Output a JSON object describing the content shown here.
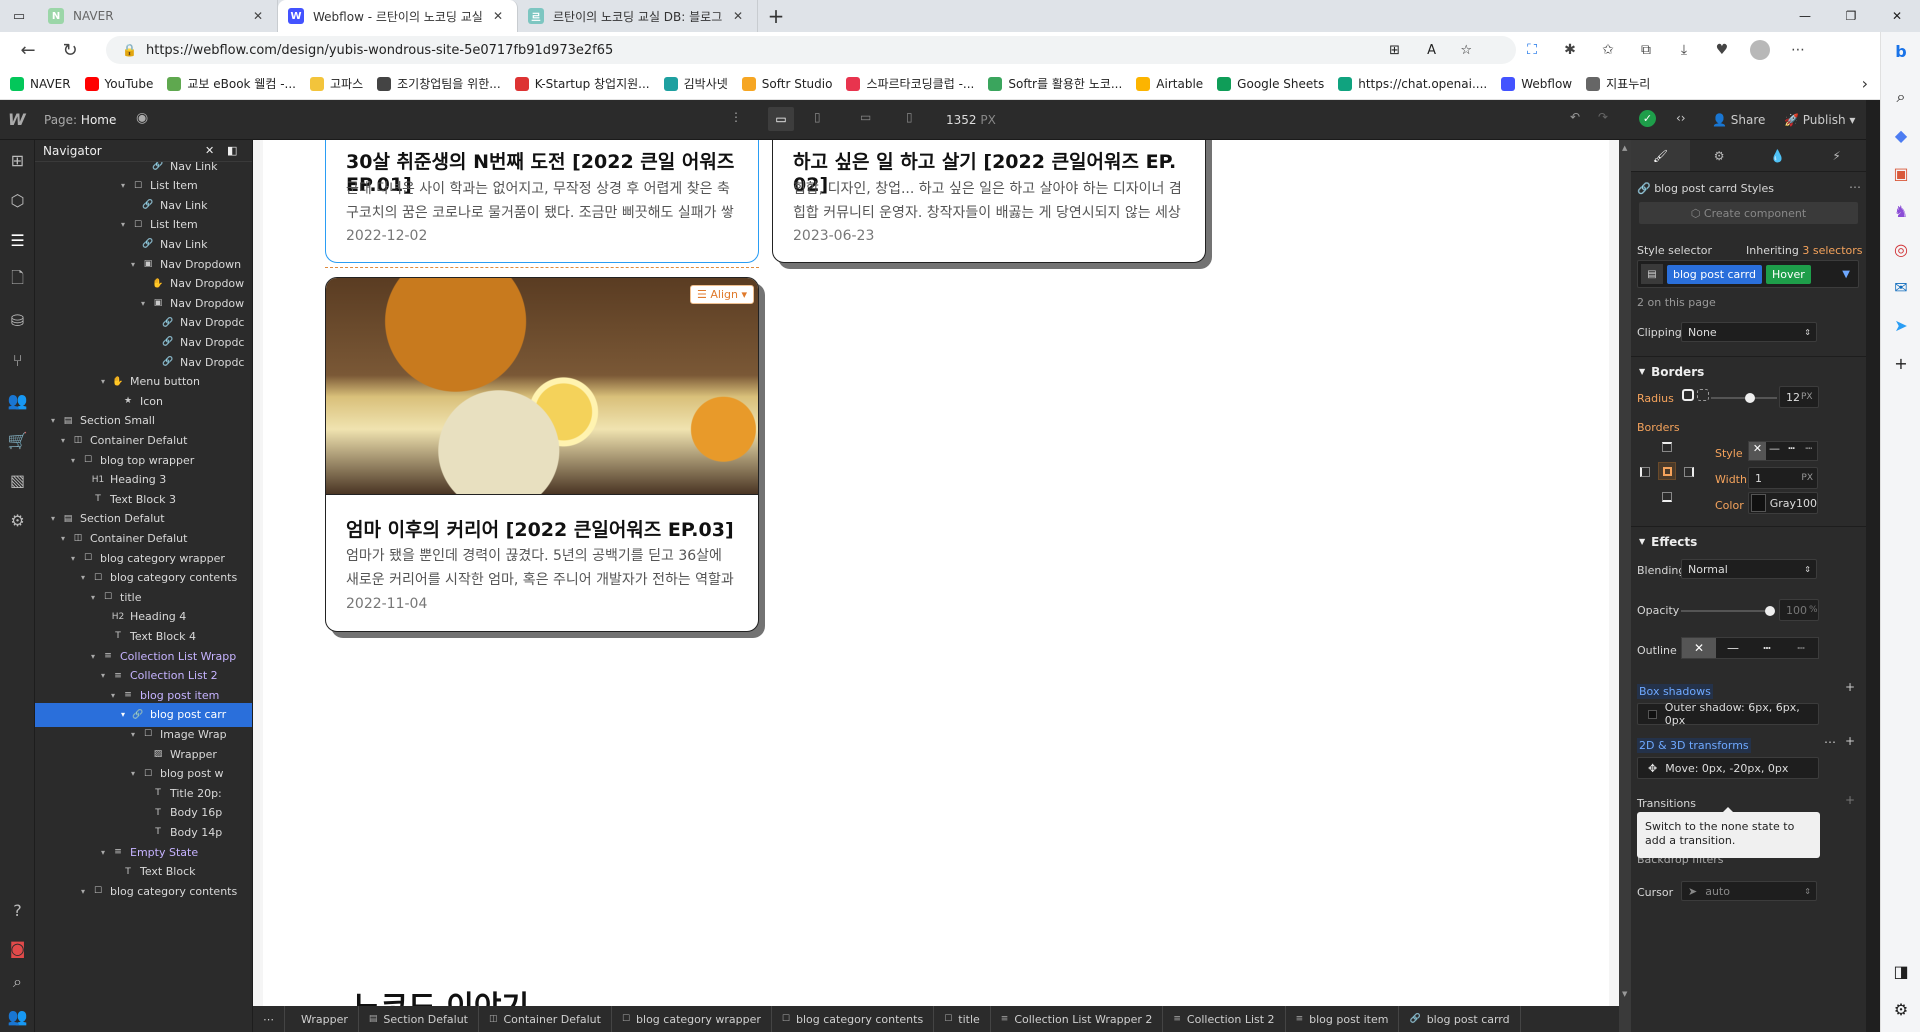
{
  "browser": {
    "tabs": [
      {
        "title": "NAVER",
        "favicon_color": "#03c75a",
        "favicon_letter": "N"
      },
      {
        "title": "Webflow - 르탄이의 노코딩 교실",
        "favicon_color": "#4353ff",
        "favicon_letter": "W"
      },
      {
        "title": "르탄이의 노코딩 교실 DB: 블로그",
        "favicon_color": "#7dc6c1",
        "favicon_letter": "르"
      }
    ],
    "url": "https://webflow.com/design/yubis-wondrous-site-5e0717fb91d973e2f65",
    "bookmarks": [
      {
        "label": "NAVER",
        "color": "#03c75a"
      },
      {
        "label": "YouTube",
        "color": "#ff0000"
      },
      {
        "label": "교보 eBook 웰컴 -...",
        "color": "#5fa84f"
      },
      {
        "label": "고파스",
        "color": "#f3c43b"
      },
      {
        "label": "조기창업팀을 위한...",
        "color": "#444444"
      },
      {
        "label": "K-Startup 창업지원...",
        "color": "#d33"
      },
      {
        "label": "김박사넷",
        "color": "#1ea0a0"
      },
      {
        "label": "Softr Studio",
        "color": "#f6a623"
      },
      {
        "label": "스파르타코딩클럽 -...",
        "color": "#e8344e"
      },
      {
        "label": "Softr를 활용한 노코...",
        "color": "#3aa55d"
      },
      {
        "label": "Airtable",
        "color": "#fcb400"
      },
      {
        "label": "Google Sheets",
        "color": "#0f9d58"
      },
      {
        "label": "https://chat.openai....",
        "color": "#10a37f"
      },
      {
        "label": "Webflow",
        "color": "#4353ff"
      },
      {
        "label": "지표누리",
        "color": "#666666"
      }
    ]
  },
  "topbar": {
    "logo": "W",
    "page_label": "Page:",
    "page_name": "Home",
    "width_value": "1352",
    "width_unit": "PX",
    "share": "Share",
    "publish": "Publish"
  },
  "navigator": {
    "title": "Navigator",
    "nodes": [
      {
        "label": "Nav Link",
        "depth": 10,
        "icon": "🔗",
        "arrow": ""
      },
      {
        "label": "List Item",
        "depth": 8,
        "icon": "☐",
        "arrow": "▾"
      },
      {
        "label": "Nav Link",
        "depth": 9,
        "icon": "🔗",
        "arrow": ""
      },
      {
        "label": "List Item",
        "depth": 8,
        "icon": "☐",
        "arrow": "▾"
      },
      {
        "label": "Nav Link",
        "depth": 9,
        "icon": "🔗",
        "arrow": ""
      },
      {
        "label": "Nav Dropdown",
        "depth": 9,
        "icon": "▣",
        "arrow": "▾"
      },
      {
        "label": "Nav Dropdow",
        "depth": 10,
        "icon": "✋",
        "arrow": ""
      },
      {
        "label": "Nav Dropdow",
        "depth": 10,
        "icon": "▣",
        "arrow": "▾"
      },
      {
        "label": "Nav Dropdc",
        "depth": 11,
        "icon": "🔗",
        "arrow": ""
      },
      {
        "label": "Nav Dropdc",
        "depth": 11,
        "icon": "🔗",
        "arrow": ""
      },
      {
        "label": "Nav Dropdc",
        "depth": 11,
        "icon": "🔗",
        "arrow": ""
      },
      {
        "label": "Menu button",
        "depth": 6,
        "icon": "✋",
        "arrow": "▾"
      },
      {
        "label": "Icon",
        "depth": 7,
        "icon": "★",
        "arrow": ""
      },
      {
        "label": "Section Small",
        "depth": 1,
        "icon": "▤",
        "arrow": "▾"
      },
      {
        "label": "Container Defalut",
        "depth": 2,
        "icon": "◫",
        "arrow": "▾"
      },
      {
        "label": "blog top wrapper",
        "depth": 3,
        "icon": "☐",
        "arrow": "▾"
      },
      {
        "label": "Heading 3",
        "depth": 4,
        "icon": "H1",
        "arrow": ""
      },
      {
        "label": "Text Block 3",
        "depth": 4,
        "icon": "T",
        "arrow": ""
      },
      {
        "label": "Section Defalut",
        "depth": 1,
        "icon": "▤",
        "arrow": "▾"
      },
      {
        "label": "Container Defalut",
        "depth": 2,
        "icon": "◫",
        "arrow": "▾"
      },
      {
        "label": "blog category wrapper",
        "depth": 3,
        "icon": "☐",
        "arrow": "▾"
      },
      {
        "label": "blog category contents",
        "depth": 4,
        "icon": "☐",
        "arrow": "▾"
      },
      {
        "label": "title",
        "depth": 5,
        "icon": "☐",
        "arrow": "▾"
      },
      {
        "label": "Heading 4",
        "depth": 6,
        "icon": "H2",
        "arrow": ""
      },
      {
        "label": "Text Block 4",
        "depth": 6,
        "icon": "T",
        "arrow": ""
      },
      {
        "label": "Collection List Wrapp",
        "depth": 5,
        "icon": "≡",
        "arrow": "▾"
      },
      {
        "label": "Collection List 2",
        "depth": 6,
        "icon": "≡",
        "arrow": "▾"
      },
      {
        "label": "blog post item",
        "depth": 7,
        "icon": "≡",
        "arrow": "▾"
      },
      {
        "label": "blog post carr",
        "depth": 8,
        "icon": "🔗",
        "arrow": "▾"
      },
      {
        "label": "Image Wrap",
        "depth": 9,
        "icon": "☐",
        "arrow": "▾"
      },
      {
        "label": "Wrapper",
        "depth": 10,
        "icon": "▨",
        "arrow": ""
      },
      {
        "label": "blog post w",
        "depth": 9,
        "icon": "☐",
        "arrow": "▾"
      },
      {
        "label": "Title 20p:",
        "depth": 10,
        "icon": "T",
        "arrow": ""
      },
      {
        "label": "Body 16p",
        "depth": 10,
        "icon": "T",
        "arrow": ""
      },
      {
        "label": "Body 14p",
        "depth": 10,
        "icon": "T",
        "arrow": ""
      },
      {
        "label": "Empty State",
        "depth": 6,
        "icon": "≡",
        "arrow": "▾"
      },
      {
        "label": "Text Block",
        "depth": 7,
        "icon": "T",
        "arrow": ""
      },
      {
        "label": "blog category contents",
        "depth": 4,
        "icon": "☐",
        "arrow": "▾"
      }
    ],
    "selected_index": 28
  },
  "cards": [
    {
      "title": "30살 취준생의 N번째 도전 [2022 큰일 어워즈 EP.01]",
      "body": "군대 다녀온 사이 학과는 없어지고, 무작정 상경 후 어렵게 찾은 축구코치의 꿈은 코로나로 물거품이 됐다. 조금만 삐끗해도 실패가 쌓이는 냉혹한 세상에서 희망",
      "date": "2022-12-02"
    },
    {
      "title": "하고 싶은 일 하고 살기 [2022 큰일어워즈 EP. 02]",
      "body": "힙합, 디자인, 창업... 하고 싶은 일은 하고 살아야 하는 디자이너 겸 힙합 커뮤니티 운영자. 창작자들이 배곯는 게 당연시되지 않는 세상을 꿈꾼다. 내가 하고 싶",
      "date": "2023-06-23"
    },
    {
      "title": "엄마 이후의 커리어 [2022 큰일어워즈 EP.03]",
      "body": "엄마가 됐을 뿐인데 경력이 끊겼다. 5년의 공백기를 딛고 36살에 새로운 커리어를 시작한 엄마, 혹은 주니어 개발자가 전하는 역할과 나 사이에서 누구도 희생시",
      "date": "2022-11-04"
    }
  ],
  "align_badge": "Align",
  "section_heading_partial": "노코드 이야기",
  "breadcrumbs": [
    "Wrapper",
    "Section Defalut",
    "Container Defalut",
    "blog category wrapper",
    "blog category contents",
    "title",
    "Collection List Wrapper 2",
    "Collection List 2",
    "blog post item",
    "blog post carrd"
  ],
  "style_panel": {
    "element_title": "blog post carrd Styles",
    "create_component": "Create component",
    "style_selector_label": "Style selector",
    "inheriting": "Inheriting",
    "selectors_count": "3 selectors",
    "class_chip": "blog post carrd",
    "state_chip": "Hover",
    "on_page": "2 on this page",
    "clipping_label": "Clipping",
    "clipping_value": "None",
    "borders_title": "Borders",
    "radius_label": "Radius",
    "radius_value": "12",
    "radius_unit": "PX",
    "borders_label": "Borders",
    "style_label": "Style",
    "width_label": "Width",
    "width_value": "1",
    "width_unit": "PX",
    "color_label": "Color",
    "color_value": "Gray100",
    "effects_title": "Effects",
    "blending_label": "Blending",
    "blending_value": "Normal",
    "opacity_label": "Opacity",
    "opacity_value": "100",
    "opacity_unit": "%",
    "outline_label": "Outline",
    "box_shadows_label": "Box shadows",
    "box_shadow_value": "Outer shadow: 6px, 6px, 0px",
    "transforms_label": "2D & 3D transforms",
    "transform_value": "Move: 0px, -20px, 0px",
    "transitions_label": "Transitions",
    "tooltip": "Switch to the none state to add a transition.",
    "backdrop_label": "Backdrop filters",
    "cursor_label": "Cursor",
    "cursor_value": "auto"
  },
  "colors": {
    "webflow_dark": "#2b2b2b",
    "selection_blue": "#2a6fdb",
    "accent_orange": "#f5a35c",
    "state_green": "#1e9e4a"
  }
}
